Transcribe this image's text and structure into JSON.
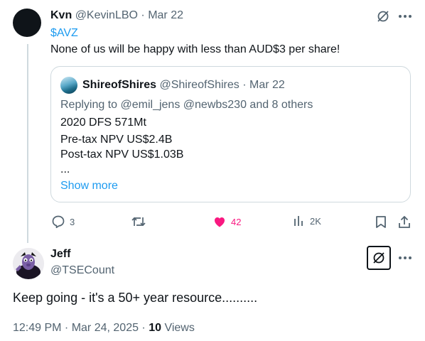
{
  "tweet": {
    "author_name": "Kvn",
    "author_handle": "@KevinLBO",
    "date": "· Mar 22",
    "cashtag": "$AVZ",
    "text": "None of us will be happy with less than AUD$3 per share!",
    "quote": {
      "author_name": "ShireofShires",
      "author_handle": "@ShireofShires",
      "date": "· Mar 22",
      "reply_prefix": "Replying to ",
      "reply_targets": "@emil_jens @newbs230",
      "reply_suffix": " and 8 others",
      "lines": [
        "2020 DFS 571Mt",
        "Pre-tax NPV US$2.4B",
        "Post-tax NPV US$1.03B",
        "..."
      ],
      "show_more": "Show more"
    },
    "actions": {
      "replies": "3",
      "reposts": "",
      "likes": "42",
      "views": "2K"
    },
    "colors": {
      "like": "#f91880",
      "link": "#1d9bf0"
    }
  },
  "reply": {
    "author_name": "Jeff",
    "author_handle": "@TSECount",
    "text": "Keep going - it's a 50+ year resource..........",
    "time": "12:49 PM · Mar 24, 2025 · ",
    "views_count": "10",
    "views_label": " Views"
  }
}
